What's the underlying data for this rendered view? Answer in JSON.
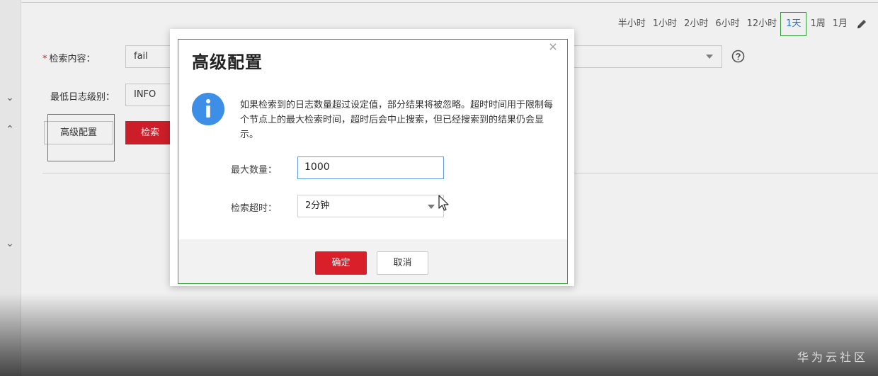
{
  "time_range": {
    "items": [
      "半小时",
      "1小时",
      "2小时",
      "6小时",
      "12小时",
      "1天",
      "1周",
      "1月"
    ],
    "active_index": 5,
    "edit_icon": "pencil-icon"
  },
  "form": {
    "search_content_label": "检索内容：",
    "search_content_value": "fail",
    "min_level_label": "最低日志级别：",
    "min_level_value": "INFO",
    "help_icon": "question-circle-icon"
  },
  "actions": {
    "advanced_label": "高级配置",
    "search_label": "检索"
  },
  "modal": {
    "title": "高级配置",
    "close_glyph": "×",
    "info_icon": "info-circle-icon",
    "info_text": "如果检索到的日志数量超过设定值，部分结果将被忽略。超时时间用于限制每个节点上的最大检索时间，超时后会中止搜索，但已经搜索到的结果仍会显示。",
    "max_count_label": "最大数量：",
    "max_count_value": "1000",
    "timeout_label": "检索超时：",
    "timeout_value": "2分钟",
    "ok_label": "确定",
    "cancel_label": "取消"
  },
  "watermark": "华为云社区",
  "colors": {
    "primary_red": "#d9202a",
    "link_blue": "#2b7cd3",
    "highlight_green": "#37a33a",
    "info_blue": "#3d8ee6"
  }
}
